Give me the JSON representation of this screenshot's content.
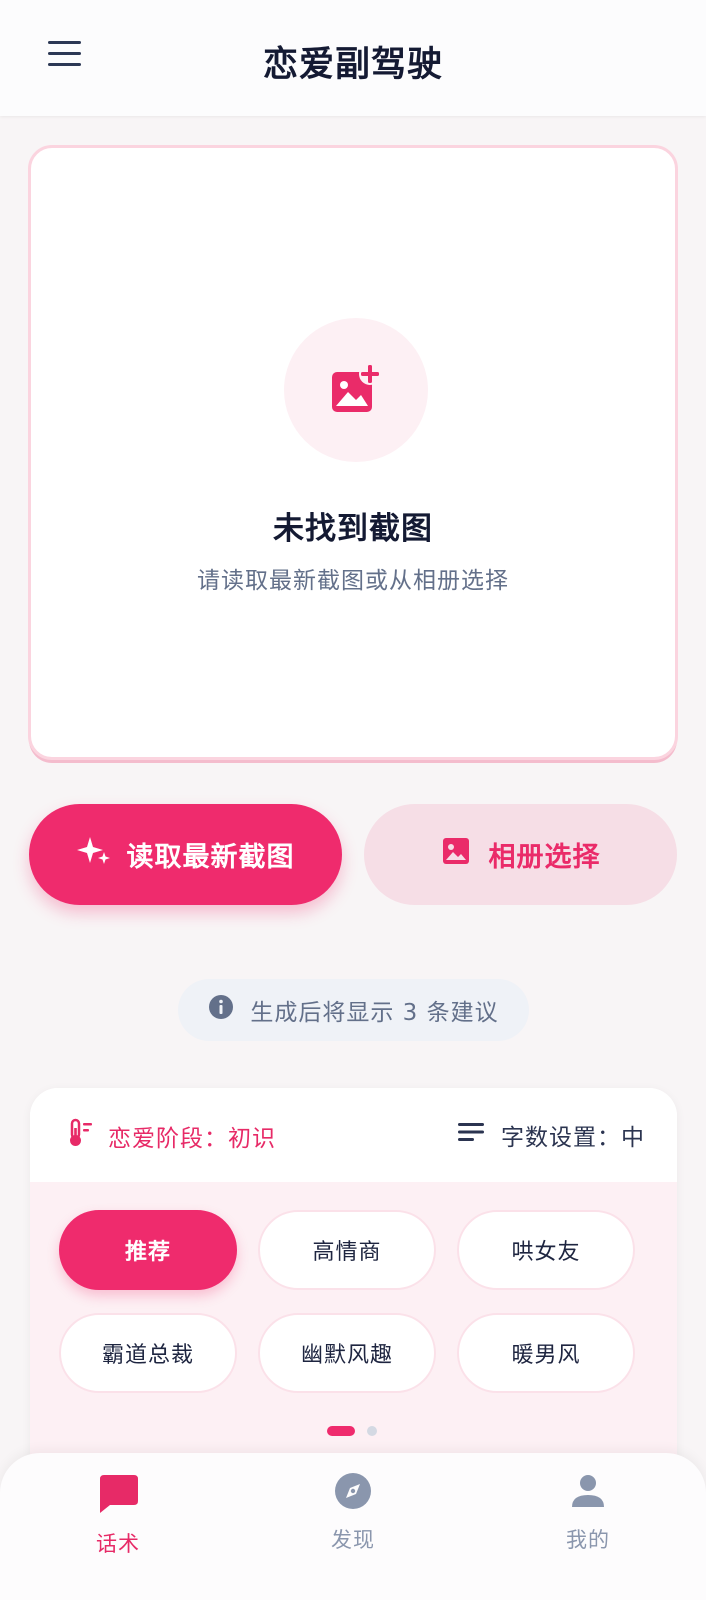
{
  "header": {
    "title": "恋爱副驾驶",
    "menu_icon": "hamburger-menu-icon"
  },
  "upload": {
    "icon": "add-photo-icon",
    "title": "未找到截图",
    "subtitle": "请读取最新截图或从相册选择"
  },
  "actions": {
    "read_latest": {
      "label": "读取最新截图",
      "icon": "sparkle-icon"
    },
    "album": {
      "label": "相册选择",
      "icon": "image-icon"
    }
  },
  "info": {
    "text": "生成后将显示 3 条建议",
    "icon": "info-icon"
  },
  "settings": {
    "stage": {
      "label": "恋爱阶段：初识",
      "icon": "thermometer-icon"
    },
    "wordcount": {
      "label": "字数设置：中",
      "icon": "lines-icon"
    },
    "styles": [
      "推荐",
      "高情商",
      "哄女友",
      "霸道总裁",
      "幽默风趣",
      "暖男风"
    ],
    "selected_style": "推荐",
    "page_indicator": {
      "current": 1,
      "total": 2
    }
  },
  "nav": {
    "items": [
      {
        "label": "话术",
        "icon": "chat-bubble-icon",
        "active": true
      },
      {
        "label": "发现",
        "icon": "compass-icon",
        "active": false
      },
      {
        "label": "我的",
        "icon": "person-icon",
        "active": false
      }
    ]
  },
  "colors": {
    "accent": "#ef2b6d",
    "accent_light": "#f6dee6",
    "background": "#f8f5f6",
    "text_dark": "#141a33",
    "text_muted": "#63708a"
  }
}
